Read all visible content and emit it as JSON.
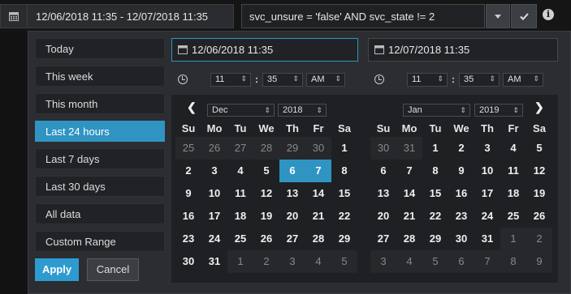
{
  "topbar": {
    "range_value": "12/06/2018 11:35 - 12/07/2018 11:35",
    "query_value": "svc_unsure = 'false' AND svc_state != 2"
  },
  "ranges": [
    "Today",
    "This week",
    "This month",
    "Last 24 hours",
    "Last 7 days",
    "Last 30 days",
    "All data",
    "Custom Range"
  ],
  "active_range": "Last 24 hours",
  "actions": {
    "apply": "Apply",
    "cancel": "Cancel"
  },
  "start": {
    "date": "12/06/2018 11:35",
    "hour": "11",
    "minute": "35",
    "ampm": "AM",
    "month": "Dec",
    "year": "2018"
  },
  "end": {
    "date": "12/07/2018 11:35",
    "hour": "11",
    "minute": "35",
    "ampm": "AM",
    "month": "Jan",
    "year": "2019"
  },
  "weekdays": [
    "Su",
    "Mo",
    "Tu",
    "We",
    "Th",
    "Fr",
    "Sa"
  ],
  "left_calendar": [
    [
      {
        "d": "25",
        "off": true
      },
      {
        "d": "26",
        "off": true
      },
      {
        "d": "27",
        "off": true
      },
      {
        "d": "28",
        "off": true
      },
      {
        "d": "29",
        "off": true
      },
      {
        "d": "30",
        "off": true
      },
      {
        "d": "1"
      }
    ],
    [
      {
        "d": "2"
      },
      {
        "d": "3"
      },
      {
        "d": "4"
      },
      {
        "d": "5"
      },
      {
        "d": "6",
        "sel": true
      },
      {
        "d": "7",
        "sel": true
      },
      {
        "d": "8"
      }
    ],
    [
      {
        "d": "9"
      },
      {
        "d": "10"
      },
      {
        "d": "11"
      },
      {
        "d": "12"
      },
      {
        "d": "13"
      },
      {
        "d": "14"
      },
      {
        "d": "15"
      }
    ],
    [
      {
        "d": "16"
      },
      {
        "d": "17"
      },
      {
        "d": "18"
      },
      {
        "d": "19"
      },
      {
        "d": "20"
      },
      {
        "d": "21"
      },
      {
        "d": "22"
      }
    ],
    [
      {
        "d": "23"
      },
      {
        "d": "24"
      },
      {
        "d": "25"
      },
      {
        "d": "26"
      },
      {
        "d": "27"
      },
      {
        "d": "28"
      },
      {
        "d": "29"
      }
    ],
    [
      {
        "d": "30"
      },
      {
        "d": "31"
      },
      {
        "d": "1",
        "off": true
      },
      {
        "d": "2",
        "off": true
      },
      {
        "d": "3",
        "off": true
      },
      {
        "d": "4",
        "off": true
      },
      {
        "d": "5",
        "off": true
      }
    ]
  ],
  "right_calendar": [
    [
      {
        "d": "30",
        "off": true
      },
      {
        "d": "31",
        "off": true
      },
      {
        "d": "1"
      },
      {
        "d": "2"
      },
      {
        "d": "3"
      },
      {
        "d": "4"
      },
      {
        "d": "5"
      }
    ],
    [
      {
        "d": "6"
      },
      {
        "d": "7"
      },
      {
        "d": "8"
      },
      {
        "d": "9"
      },
      {
        "d": "10"
      },
      {
        "d": "11"
      },
      {
        "d": "12"
      }
    ],
    [
      {
        "d": "13"
      },
      {
        "d": "14"
      },
      {
        "d": "15"
      },
      {
        "d": "16"
      },
      {
        "d": "17"
      },
      {
        "d": "18"
      },
      {
        "d": "19"
      }
    ],
    [
      {
        "d": "20"
      },
      {
        "d": "21"
      },
      {
        "d": "22"
      },
      {
        "d": "23"
      },
      {
        "d": "24"
      },
      {
        "d": "25"
      },
      {
        "d": "26"
      }
    ],
    [
      {
        "d": "27"
      },
      {
        "d": "28"
      },
      {
        "d": "29"
      },
      {
        "d": "30"
      },
      {
        "d": "31"
      },
      {
        "d": "1",
        "off": true
      },
      {
        "d": "2",
        "off": true
      }
    ],
    [
      {
        "d": "3",
        "off": true
      },
      {
        "d": "4",
        "off": true
      },
      {
        "d": "5",
        "off": true
      },
      {
        "d": "6",
        "off": true
      },
      {
        "d": "7",
        "off": true
      },
      {
        "d": "8",
        "off": true
      },
      {
        "d": "9",
        "off": true
      }
    ]
  ],
  "colors": {
    "accent": "#3094c3",
    "panel": "#2b2d31",
    "background": "#121212"
  },
  "icons": [
    "calendar-icon",
    "chevron-down-icon",
    "check-icon",
    "info-icon",
    "clock-icon",
    "chevron-left-icon",
    "chevron-right-icon"
  ]
}
